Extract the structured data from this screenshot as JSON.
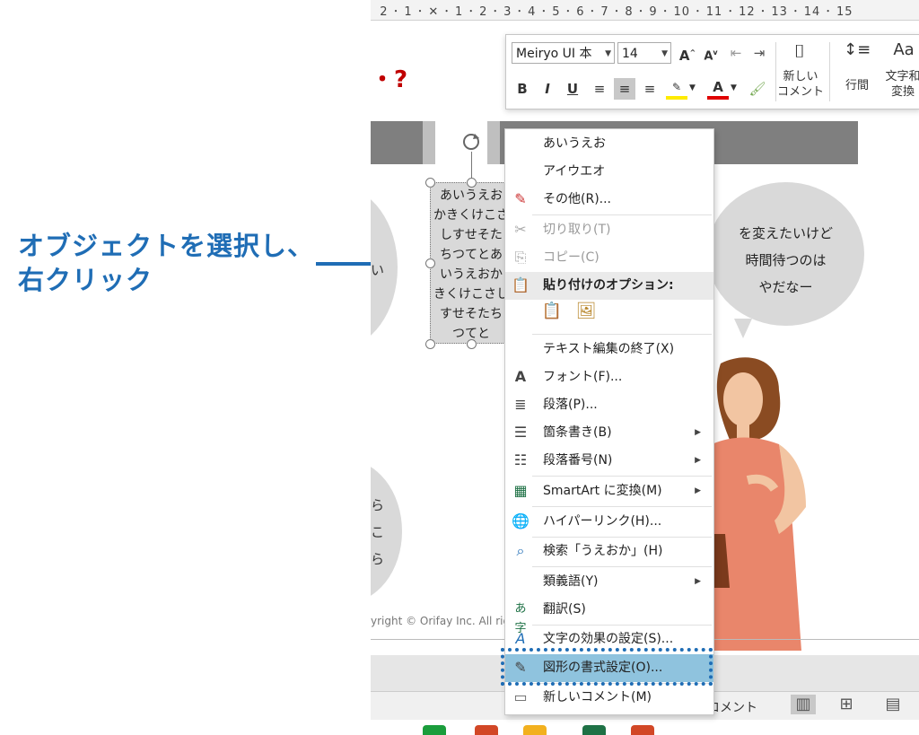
{
  "annotation": {
    "line1": "オブジェクトを選択し、",
    "line2": "右クリック",
    "color": "#1f6db5"
  },
  "ruler": {
    "marks": [
      "2",
      "1",
      "1",
      "2",
      "3",
      "4",
      "5",
      "6",
      "7",
      "8",
      "9",
      "10",
      "11",
      "12",
      "13",
      "14",
      "15"
    ]
  },
  "slide": {
    "title_fragment": "・?",
    "left_fragment_1": "い",
    "left_fragment_2a": "ら",
    "left_fragment_2b": "こ",
    "left_fragment_2c": "ら",
    "textbox_lines": [
      "あいうえお",
      "かきくけこさ",
      "しすせそた",
      "ちつてとあ",
      "いうえおか",
      "きくけこさし",
      "すせそたち",
      "つてと"
    ],
    "bubble_lines": [
      "を変えたいけど",
      "時間待つのは",
      "やだなー"
    ],
    "copyright": "yright © Orifay Inc. All righ"
  },
  "mini_toolbar": {
    "font_name": "Meiryo UI 本",
    "font_size": "14",
    "grow_font": "A",
    "shrink_font": "A",
    "bold": "B",
    "italic": "I",
    "underline": "U",
    "new_comment_line1": "新しい",
    "new_comment_line2": "コメント",
    "line_spacing": "行間",
    "text_convert_line1": "文字和",
    "text_convert_line2": "変換",
    "aa": "Aa"
  },
  "context_menu": {
    "items": [
      {
        "label": "あいうえお"
      },
      {
        "label": "アイウエオ"
      },
      {
        "label": "その他(R)..."
      },
      {
        "label": "切り取り(T)"
      },
      {
        "label": "コピー(C)"
      },
      {
        "label": "貼り付けのオプション:"
      },
      {
        "label": "テキスト編集の終了(X)"
      },
      {
        "label": "フォント(F)..."
      },
      {
        "label": "段落(P)..."
      },
      {
        "label": "箇条書き(B)"
      },
      {
        "label": "段落番号(N)"
      },
      {
        "label": "SmartArt に変換(M)"
      },
      {
        "label": "ハイパーリンク(H)..."
      },
      {
        "label": "検索「うえおか」(H)"
      },
      {
        "label": "類義語(Y)"
      },
      {
        "label": "翻訳(S)"
      },
      {
        "label": "文字の効果の設定(S)..."
      },
      {
        "label": "図形の書式設定(O)..."
      },
      {
        "label": "新しいコメント(M)"
      }
    ],
    "highlight_color": "#8fc3de"
  },
  "statusbar": {
    "comment_label": "コメント"
  }
}
